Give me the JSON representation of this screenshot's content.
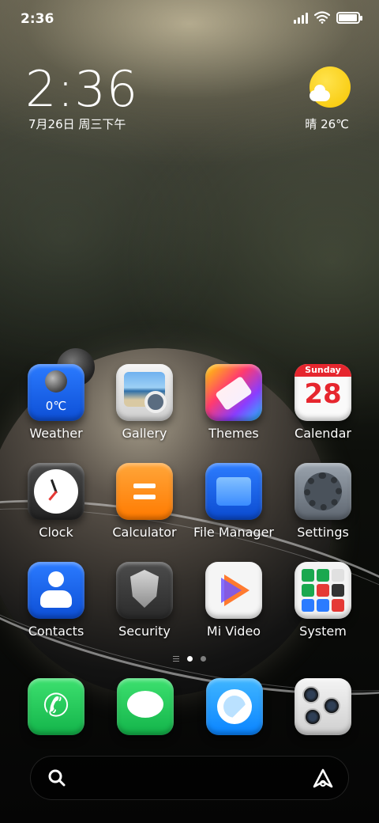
{
  "status_bar": {
    "time": "2:36",
    "icons": [
      "signal-icon",
      "wifi-icon",
      "battery-icon"
    ],
    "battery_level": 0.95
  },
  "clock_widget": {
    "time": "2:36",
    "date": "7月26日 周三下午"
  },
  "weather_widget": {
    "text": "晴 26℃",
    "icon": "sun-cloud-icon",
    "sun_color": "#f7c600"
  },
  "apps": [
    {
      "label": "Weather",
      "icon": "weather-icon",
      "badge_text": "0℃"
    },
    {
      "label": "Gallery",
      "icon": "gallery-icon"
    },
    {
      "label": "Themes",
      "icon": "themes-icon"
    },
    {
      "label": "Calendar",
      "icon": "calendar-icon",
      "header": "Sunday",
      "day": "28"
    },
    {
      "label": "Clock",
      "icon": "clock-icon"
    },
    {
      "label": "Calculator",
      "icon": "calculator-icon"
    },
    {
      "label": "File Manager",
      "icon": "folder-icon"
    },
    {
      "label": "Settings",
      "icon": "gear-icon"
    },
    {
      "label": "Contacts",
      "icon": "contacts-icon"
    },
    {
      "label": "Security",
      "icon": "shield-icon"
    },
    {
      "label": "Mi Video",
      "icon": "play-icon"
    },
    {
      "label": "System",
      "icon": "system-folder-icon"
    }
  ],
  "page_indicator": {
    "pages": 2,
    "active_page": 1
  },
  "dock": [
    {
      "icon": "phone-icon"
    },
    {
      "icon": "messages-icon"
    },
    {
      "icon": "browser-icon"
    },
    {
      "icon": "camera-icon"
    }
  ],
  "search_bar": {
    "icons": [
      "search-icon",
      "assistant-icon"
    ]
  },
  "colors": {
    "accent_blue": "#2b7bff",
    "calendar_red": "#e6262e",
    "dock_green": "#13b44a"
  }
}
